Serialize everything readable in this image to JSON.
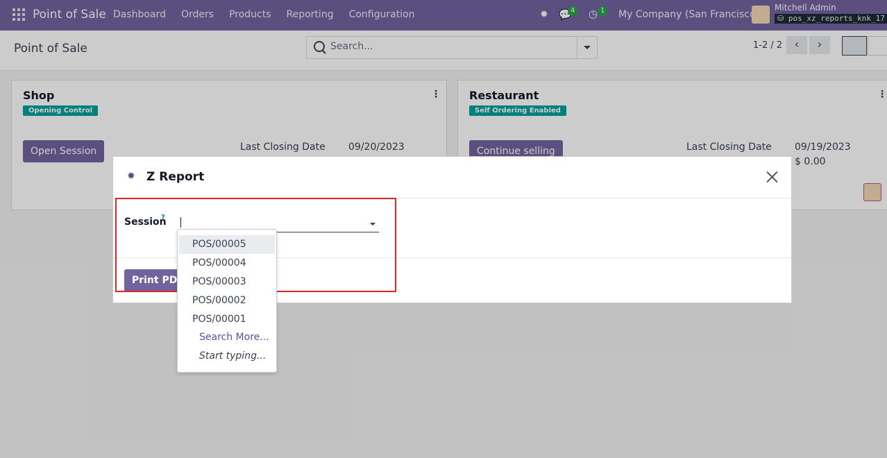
{
  "navbar": {
    "brand": "Point of Sale",
    "menu": [
      "Dashboard",
      "Orders",
      "Products",
      "Reporting",
      "Configuration"
    ],
    "chat_count": "4",
    "activity_count": "1",
    "company": "My Company (San Francisco)",
    "user": "Mitchell Admin",
    "database": "pos_xz_reports_knk_17"
  },
  "control": {
    "title": "Point of Sale",
    "search_placeholder": "Search...",
    "pager": "1-2 / 2"
  },
  "cards": [
    {
      "title": "Shop",
      "tag": "Opening Control",
      "button": "Open Session",
      "closing_label": "Last Closing Date",
      "closing_date": "09/20/2023"
    },
    {
      "title": "Restaurant",
      "tag": "Self Ordering Enabled",
      "button": "Continue selling",
      "closing_label": "Last Closing Date",
      "closing_date": "09/19/2023",
      "amount": "$ 0.00"
    }
  ],
  "modal": {
    "title": "Z Report",
    "field_label": "Session",
    "help": "?",
    "print_button": "Print PDF"
  },
  "dropdown": {
    "items": [
      "POS/00005",
      "POS/00004",
      "POS/00003",
      "POS/00002",
      "POS/00001"
    ],
    "search_more": "Search More...",
    "hint": "Start typing..."
  },
  "colors": {
    "brand": "#71639e",
    "tag": "#00a09d",
    "highlight": "#dc2626"
  }
}
